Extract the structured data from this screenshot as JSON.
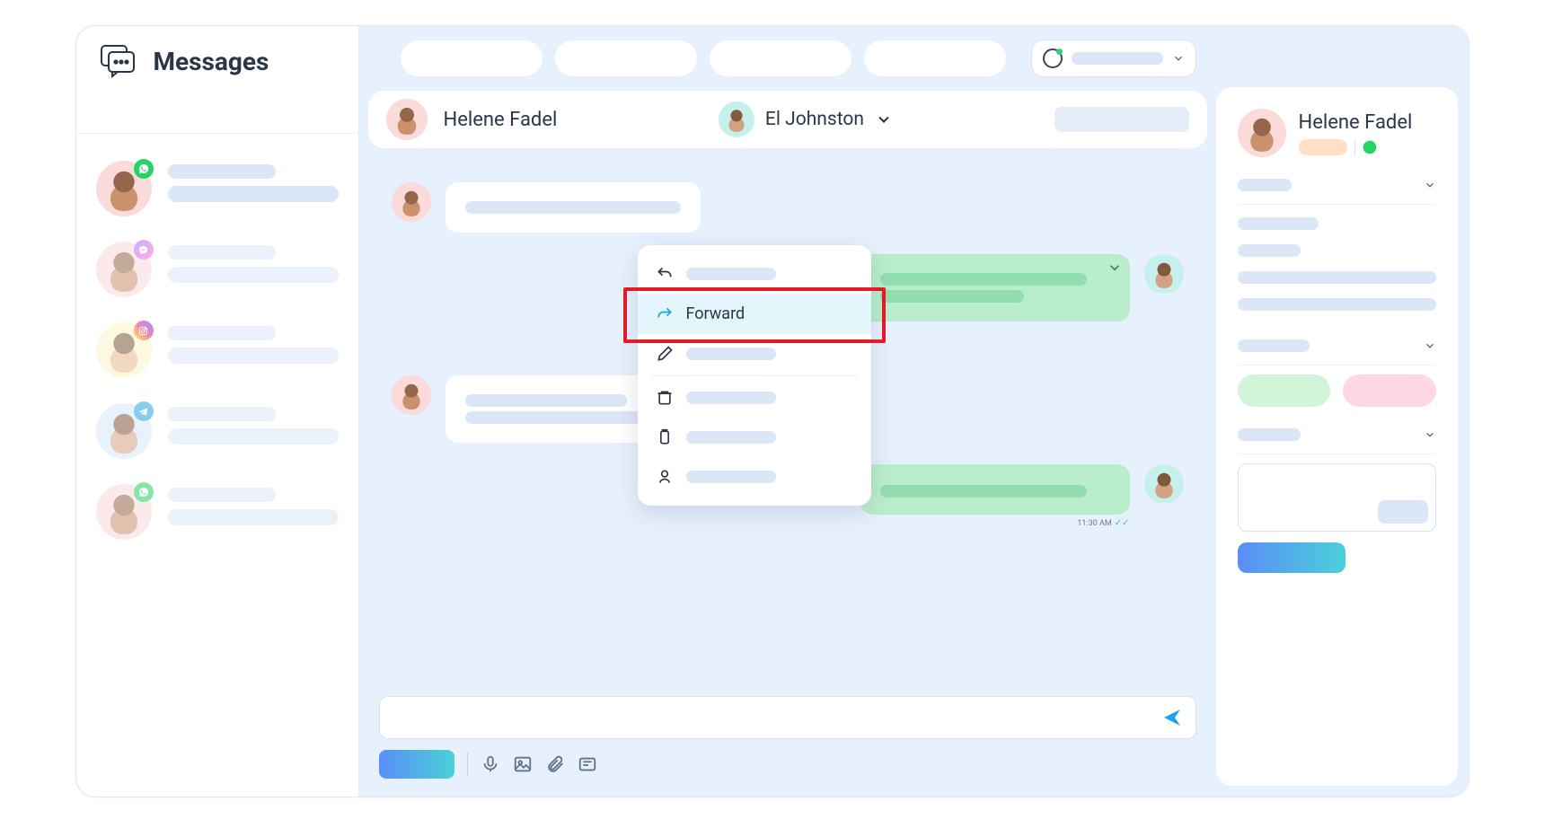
{
  "sidebar": {
    "title": "Messages",
    "conversations": [
      {
        "channel": "whatsapp",
        "active": true
      },
      {
        "channel": "messenger",
        "active": false
      },
      {
        "channel": "instagram",
        "active": false
      },
      {
        "channel": "telegram",
        "active": false
      },
      {
        "channel": "whatsapp",
        "active": false
      }
    ]
  },
  "chat": {
    "contact_name": "Helene Fadel",
    "agent_name": "El Johnston",
    "last_timestamp": "11:30 AM",
    "context_menu": {
      "forward_label": "Forward",
      "highlighted": "forward"
    }
  },
  "right_panel": {
    "contact_name": "Helene Fadel",
    "channel": "whatsapp"
  },
  "colors": {
    "accent_blue": "#1ea0ea",
    "bubble_green": "#baeecb",
    "highlight_red": "#e31b23"
  }
}
